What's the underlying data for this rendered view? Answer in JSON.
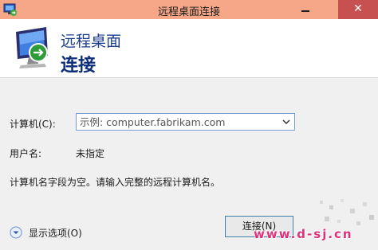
{
  "window": {
    "title": "远程桌面连接",
    "close_glyph": "✕"
  },
  "header": {
    "title": "远程桌面",
    "subtitle": "连接"
  },
  "form": {
    "computer_label": "计算机(C):",
    "computer_placeholder": "示例: computer.fabrikam.com",
    "username_label": "用户名:",
    "username_value": "未指定",
    "message": "计算机名字段为空。请输入完整的远程计算机名。"
  },
  "footer": {
    "options_label": "显示选项(O)",
    "connect_label": "连接(N)"
  },
  "watermark": "www.d-sj.cn",
  "icons": {
    "app": "remote-desktop-icon",
    "header": "remote-desktop-monitor-icon",
    "dropdown": "chevron-down-icon",
    "options": "chevron-circle-down-icon"
  },
  "colors": {
    "titlebar": "#f5a787",
    "close": "#c75050",
    "header_text": "#1a3d8c",
    "accent_border": "#7a9ad6"
  }
}
